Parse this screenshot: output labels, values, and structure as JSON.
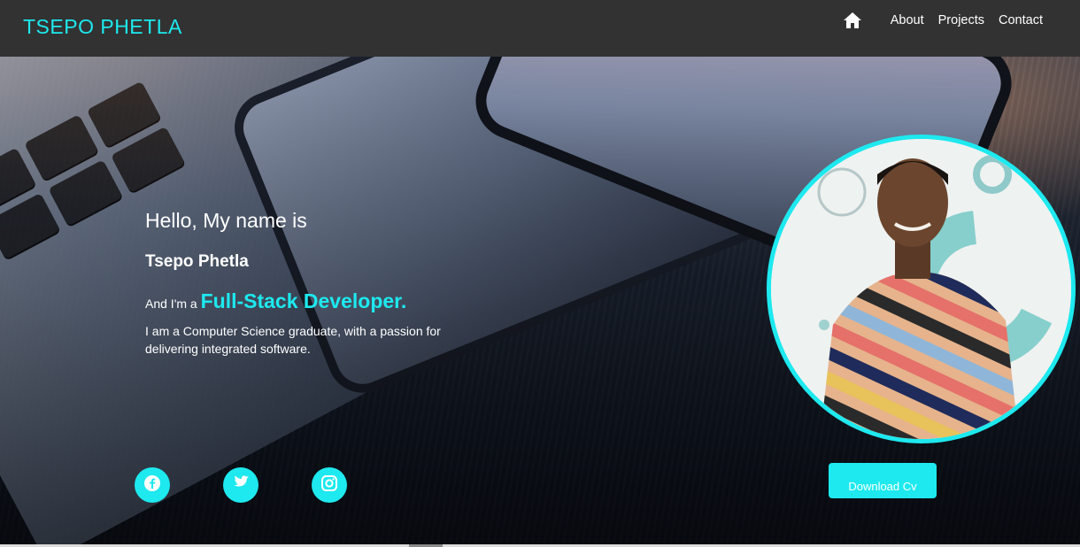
{
  "navbar": {
    "brand": "TSEPO PHETLA",
    "home_icon": "home-icon",
    "links": [
      {
        "label": "About"
      },
      {
        "label": "Projects"
      },
      {
        "label": "Contact"
      }
    ]
  },
  "hero": {
    "greeting": "Hello, My name is",
    "name": "Tsepo Phetla",
    "role_prefix": "And I'm a",
    "role_highlight": "Full-Stack Developer.",
    "description": "I am a Computer Science graduate, with a passion for delivering integrated software."
  },
  "social": [
    {
      "icon": "facebook-icon"
    },
    {
      "icon": "twitter-icon"
    },
    {
      "icon": "instagram-icon"
    }
  ],
  "cv_button": {
    "label": "Download Cv"
  },
  "colors": {
    "accent": "#1de9ef",
    "navbar": "#323232",
    "text": "#ffffff"
  }
}
